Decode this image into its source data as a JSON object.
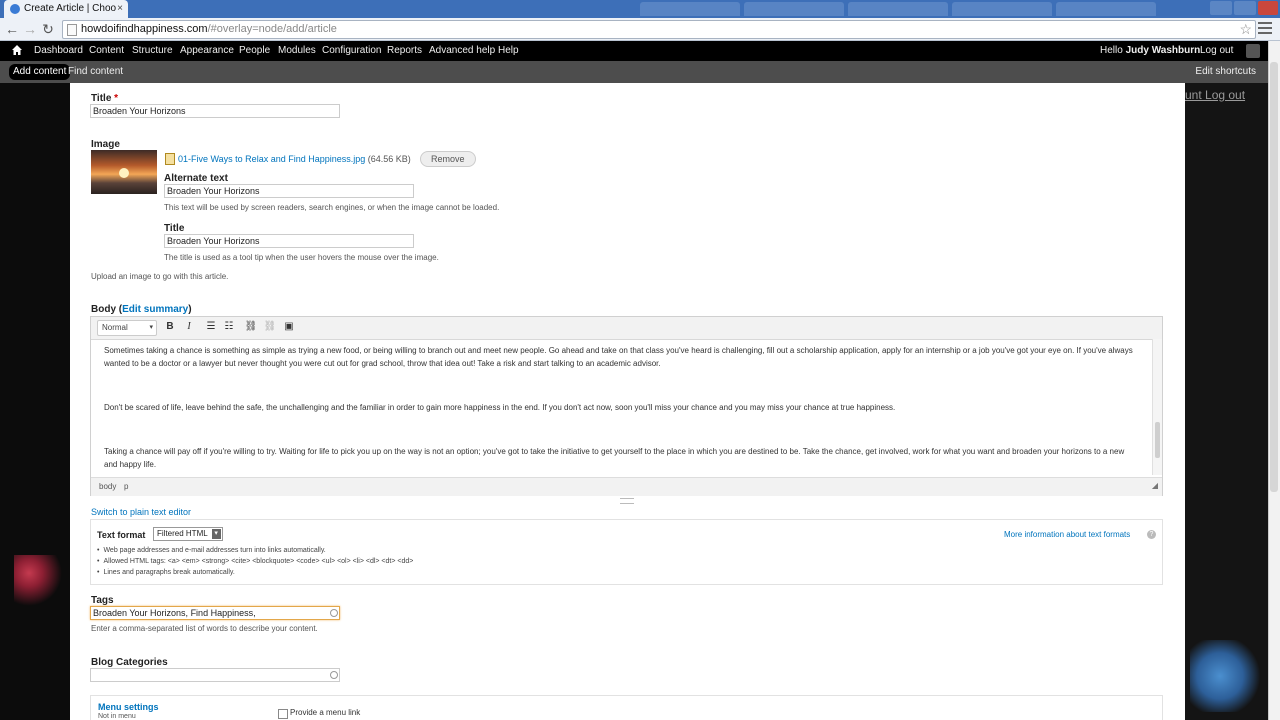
{
  "browser": {
    "tab_title": "Create Article | Choose Jo",
    "tab_close": "×",
    "url_host": "howdoifindhappiness.com",
    "url_path": "/#overlay=node/add/article"
  },
  "toolbar": {
    "items": [
      "Dashboard",
      "Content",
      "Structure",
      "Appearance",
      "People",
      "Modules",
      "Configuration",
      "Reports",
      "Advanced help",
      "Help"
    ],
    "hello": "Hello",
    "user": "Judy Washburn",
    "logout": "Log out"
  },
  "shortcuts": {
    "add_content": "Add content",
    "find_content": "Find content",
    "edit_shortcuts": "Edit shortcuts"
  },
  "background": {
    "links": "unt   Log out"
  },
  "form": {
    "title_label": "Title",
    "required_mark": "*",
    "title_value": "Broaden Your Horizons",
    "image_label": "Image",
    "file_name": "01-Five Ways to Relax and Find Happiness.jpg",
    "file_size": "(64.56 KB)",
    "remove_label": "Remove",
    "alt_label": "Alternate text",
    "alt_value": "Broaden Your Horizons",
    "alt_desc": "This text will be used by screen readers, search engines, or when the image cannot be loaded.",
    "img_title_label": "Title",
    "img_title_value": "Broaden Your Horizons",
    "img_title_desc": "The title is used as a tool tip when the user hovers the mouse over the image.",
    "upload_desc": "Upload an image to go with this article.",
    "body_label": "Body",
    "edit_summary": "Edit summary",
    "editor_format": "Normal",
    "body_paragraphs": [
      "Sometimes taking a chance is something as simple as trying a new food, or being willing to branch out and meet new people.  Go ahead and take on that class you've heard is challenging, fill out a scholarship application, apply for an internship or a job you've got your eye on.  If you've always wanted to be a doctor or a lawyer but never thought you were cut out for grad school, throw that idea out! Take a risk and start talking to an academic advisor.",
      "Don't be scared of life, leave behind the safe, the unchallenging and the familiar in order to gain more happiness in the end.  If you don't act now, soon you'll miss your chance and you may miss your chance at true happiness.",
      "Taking a chance will pay off if you're willing to try. Waiting for life to pick you up on the way is not an option; you've got to take the initiative to get yourself to the place in which you are destined to be. Take the chance, get involved, work for what you want and broaden your horizons to a new and happy life."
    ],
    "path_body": "body",
    "path_p": "p",
    "switch_editor": "Switch to plain text editor",
    "text_format_label": "Text format",
    "text_format_value": "Filtered HTML",
    "more_info": "More information about text formats",
    "format_tips": [
      "Web page addresses and e-mail addresses turn into links automatically.",
      "Allowed HTML tags: <a> <em> <strong> <cite> <blockquote> <code> <ul> <ol> <li> <dl> <dt> <dd>",
      "Lines and paragraphs break automatically."
    ],
    "tags_label": "Tags",
    "tags_value": "Broaden Your Horizons, Find Happiness,",
    "tags_desc": "Enter a comma-separated list of words to describe your content.",
    "blog_categories_label": "Blog Categories",
    "blog_categories_value": "",
    "menu_settings_label": "Menu settings",
    "menu_settings_sub": "Not in menu",
    "provide_menu_link": "Provide a menu link"
  },
  "icons": {
    "home": "home-icon",
    "star": "star-icon",
    "wrench": "wrench-icon"
  }
}
